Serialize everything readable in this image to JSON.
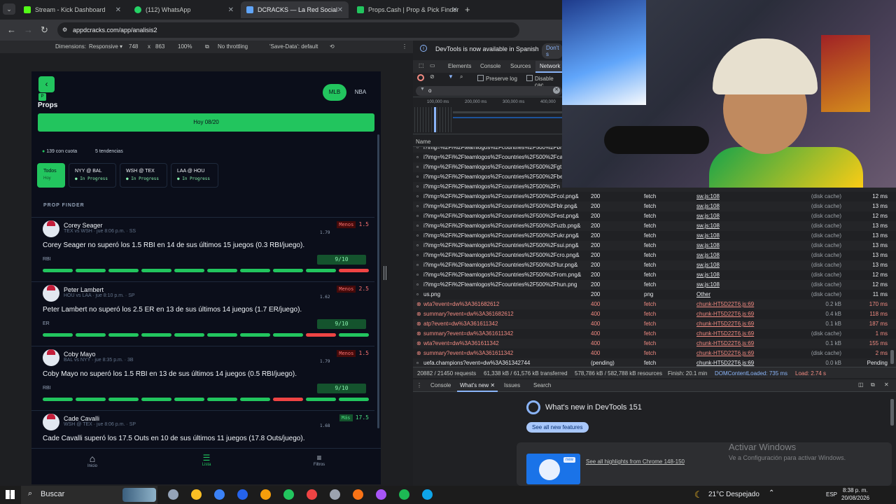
{
  "browser": {
    "tabs": [
      {
        "label": "Stream - Kick Dashboard",
        "color": "#53fc18",
        "active": false
      },
      {
        "label": "(112) WhatsApp",
        "color": "#25d366",
        "active": false
      },
      {
        "label": "DCRACKS — La Red Social #1 d",
        "color": "#60a5fa",
        "active": true
      },
      {
        "label": "Props.Cash | Prop & Pick Finder",
        "color": "#22c55e",
        "active": false
      }
    ],
    "url": "appdcracks.com/app/analisis2"
  },
  "devbar": {
    "dimensions": "Dimensions:",
    "responsive": "Responsive",
    "width": "748",
    "x": "x",
    "height": "863",
    "zoom": "100%",
    "throttle": "No throttling",
    "savedata": "'Save-Data': default"
  },
  "app": {
    "leagues": [
      "MLB",
      "NBA"
    ],
    "title": "Props",
    "date": "Hoy 08/20",
    "count_ok": "139 con cuota",
    "count_trend": "5 tendencias",
    "games": [
      {
        "label": "Todos",
        "sub": "Hoy"
      },
      {
        "label": "NYY @ BAL",
        "sub": "In Progress"
      },
      {
        "label": "WSH @ TEX",
        "sub": "In Progress"
      },
      {
        "label": "LAA @ HOU",
        "sub": "In Progress"
      }
    ],
    "section": "PROP FINDER",
    "props": [
      {
        "name": "Corey Seager",
        "meta": "TEX vs WSH · jue 8:06 p.m. · SS",
        "side": "Menos",
        "line": "1.5",
        "odds": "1.79",
        "text": "Corey Seager no superó los 1.5 RBI en 14 de sus últimos 15 juegos (0.3 RBI/juego).",
        "stat": "RBI",
        "score": "9/10",
        "hits": [
          1,
          1,
          1,
          1,
          1,
          1,
          1,
          1,
          1,
          0
        ]
      },
      {
        "name": "Peter Lambert",
        "meta": "HOU vs LAA · jue 8:10 p.m. · SP",
        "side": "Menos",
        "line": "2.5",
        "odds": "1.62",
        "text": "Peter Lambert no superó los 2.5 ER en 13 de sus últimos 14 juegos (1.7 ER/juego).",
        "stat": "ER",
        "score": "9/10",
        "hits": [
          1,
          1,
          1,
          1,
          1,
          1,
          1,
          1,
          0,
          1
        ]
      },
      {
        "name": "Coby Mayo",
        "meta": "BAL vs NYY · jue 8:35 p.m. · 3B",
        "side": "Menos",
        "line": "1.5",
        "odds": "1.79",
        "text": "Coby Mayo no superó los 1.5 RBI en 13 de sus últimos 14 juegos (0.5 RBI/juego).",
        "stat": "RBI",
        "score": "9/10",
        "hits": [
          1,
          1,
          1,
          1,
          1,
          1,
          1,
          0,
          1,
          1
        ]
      },
      {
        "name": "Cade Cavalli",
        "meta": "WSH @ TEX · jue 8:06 p.m. · SP",
        "side": "Más",
        "line": "17.5",
        "odds": "1.68",
        "text": "Cade Cavalli superó los 17.5 Outs en 10 de sus últimos 11 juegos (17.8 Outs/juego).",
        "stat": "",
        "score": "",
        "hits": []
      }
    ],
    "nav": [
      "Inicio",
      "Lista",
      "Filtros"
    ]
  },
  "devtools": {
    "banner": "DevTools is now available in Spanish",
    "dont": "Don't s",
    "tabs": [
      "Elements",
      "Console",
      "Sources",
      "Network"
    ],
    "preserve": "Preserve log",
    "disable": "Disable cac",
    "filter": "o",
    "ticks": [
      "100,000 ms",
      "200,000 ms",
      "300,000 ms",
      "400,000"
    ],
    "name_col": "Name",
    "rows": [
      {
        "name": "i?img=%2Fi%2Fteamlogos%2Fcountries%2F500%2Fbi",
        "status": "",
        "type": "",
        "init": "",
        "size": "",
        "time": "",
        "err": false
      },
      {
        "name": "i?img=%2Fi%2Fteamlogos%2Fcountries%2F500%2Fca",
        "status": "",
        "type": "",
        "init": "",
        "size": "",
        "time": "",
        "err": false
      },
      {
        "name": "i?img=%2Fi%2Fteamlogos%2Fcountries%2F500%2Fgt",
        "status": "",
        "type": "",
        "init": "",
        "size": "",
        "time": "",
        "err": false
      },
      {
        "name": "i?img=%2Fi%2Fteamlogos%2Fcountries%2F500%2Fbe",
        "status": "",
        "type": "",
        "init": "",
        "size": "",
        "time": "",
        "err": false
      },
      {
        "name": "i?img=%2Fi%2Fteamlogos%2Fcountries%2F500%2Fn",
        "status": "",
        "type": "",
        "init": "",
        "size": "",
        "time": "",
        "err": false
      },
      {
        "name": "i?img=%2Fi%2Fteamlogos%2Fcountries%2F500%2Fcol.png&",
        "status": "200",
        "type": "fetch",
        "init": "sw.js:108",
        "size": "(disk cache)",
        "time": "12 ms",
        "err": false
      },
      {
        "name": "i?img=%2Fi%2Fteamlogos%2Fcountries%2F500%2Fblr.png&",
        "status": "200",
        "type": "fetch",
        "init": "sw.js:108",
        "size": "(disk cache)",
        "time": "13 ms",
        "err": false
      },
      {
        "name": "i?img=%2Fi%2Fteamlogos%2Fcountries%2F500%2Fest.png&",
        "status": "200",
        "type": "fetch",
        "init": "sw.js:108",
        "size": "(disk cache)",
        "time": "12 ms",
        "err": false
      },
      {
        "name": "i?img=%2Fi%2Fteamlogos%2Fcountries%2F500%2Fuzb.png&",
        "status": "200",
        "type": "fetch",
        "init": "sw.js:108",
        "size": "(disk cache)",
        "time": "13 ms",
        "err": false
      },
      {
        "name": "i?img=%2Fi%2Fteamlogos%2Fcountries%2F500%2Fukr.png&",
        "status": "200",
        "type": "fetch",
        "init": "sw.js:108",
        "size": "(disk cache)",
        "time": "13 ms",
        "err": false
      },
      {
        "name": "i?img=%2Fi%2Fteamlogos%2Fcountries%2F500%2Fsui.png&",
        "status": "200",
        "type": "fetch",
        "init": "sw.js:108",
        "size": "(disk cache)",
        "time": "13 ms",
        "err": false
      },
      {
        "name": "i?img=%2Fi%2Fteamlogos%2Fcountries%2F500%2Fcro.png&",
        "status": "200",
        "type": "fetch",
        "init": "sw.js:108",
        "size": "(disk cache)",
        "time": "13 ms",
        "err": false
      },
      {
        "name": "i?img=%2Fi%2Fteamlogos%2Fcountries%2F500%2Ftur.png&",
        "status": "200",
        "type": "fetch",
        "init": "sw.js:108",
        "size": "(disk cache)",
        "time": "13 ms",
        "err": false
      },
      {
        "name": "i?img=%2Fi%2Fteamlogos%2Fcountries%2F500%2From.png&",
        "status": "200",
        "type": "fetch",
        "init": "sw.js:108",
        "size": "(disk cache)",
        "time": "12 ms",
        "err": false
      },
      {
        "name": "i?img=%2Fi%2Fteamlogos%2Fcountries%2F500%2Fhun.png",
        "status": "200",
        "type": "fetch",
        "init": "sw.js:108",
        "size": "(disk cache)",
        "time": "12 ms",
        "err": false
      },
      {
        "name": "us.png",
        "status": "200",
        "type": "png",
        "init": "Other",
        "size": "(disk cache)",
        "time": "11 ms",
        "err": false
      },
      {
        "name": "wta?event=dw%3A361682612",
        "status": "400",
        "type": "fetch",
        "init": "chunk-HT5D22T6.js:69",
        "size": "0.2 kB",
        "time": "170 ms",
        "err": true
      },
      {
        "name": "summary?event=dw%3A361682612",
        "status": "400",
        "type": "fetch",
        "init": "chunk-HT5D22T6.js:69",
        "size": "0.4 kB",
        "time": "118 ms",
        "err": true
      },
      {
        "name": "atp?event=dw%3A361611342",
        "status": "400",
        "type": "fetch",
        "init": "chunk-HT5D22T6.js:69",
        "size": "0.1 kB",
        "time": "187 ms",
        "err": true
      },
      {
        "name": "summary?event=dw%3A361611342",
        "status": "400",
        "type": "fetch",
        "init": "chunk-HT5D22T6.js:69",
        "size": "(disk cache)",
        "time": "1 ms",
        "err": true
      },
      {
        "name": "wta?event=dw%3A361611342",
        "status": "400",
        "type": "fetch",
        "init": "chunk-HT5D22T6.js:69",
        "size": "0.1 kB",
        "time": "155 ms",
        "err": true
      },
      {
        "name": "summary?event=dw%3A361611342",
        "status": "400",
        "type": "fetch",
        "init": "chunk-HT5D22T6.js:69",
        "size": "(disk cache)",
        "time": "2 ms",
        "err": true
      },
      {
        "name": "uefa.champions?event=dw%3A361342744",
        "status": "(pending)",
        "type": "fetch",
        "init": "chunk-HT5D22T6.js:69",
        "size": "0.0 kB",
        "time": "Pending",
        "err": false
      }
    ],
    "summary": [
      "20882 / 21450 requests",
      "61,338 kB / 61,576 kB transferred",
      "578,786 kB / 582,788 kB resources",
      "Finish: 20.1 min",
      "DOMContentLoaded: 735 ms",
      "Load: 2.74 s"
    ],
    "drawer_tabs": [
      "Console",
      "What's new",
      "Issues",
      "Search"
    ],
    "whatsnew": "What's new in DevTools 151",
    "all_features": "See all new features",
    "highlights": "See all highlights from Chrome 148-150",
    "new_badge": "new"
  },
  "watermark": {
    "title": "Activar Windows",
    "sub": "Ve a Configuración para activar Windows."
  },
  "taskbar": {
    "search": "Buscar",
    "weather": "21°C  Despejado",
    "lang": "ESP",
    "time": "8:38 p. m.",
    "date": "20/08/2026"
  },
  "colors": {
    "accent": "#22c55e",
    "error": "#f28b82",
    "bg": "#0b0e1a"
  }
}
